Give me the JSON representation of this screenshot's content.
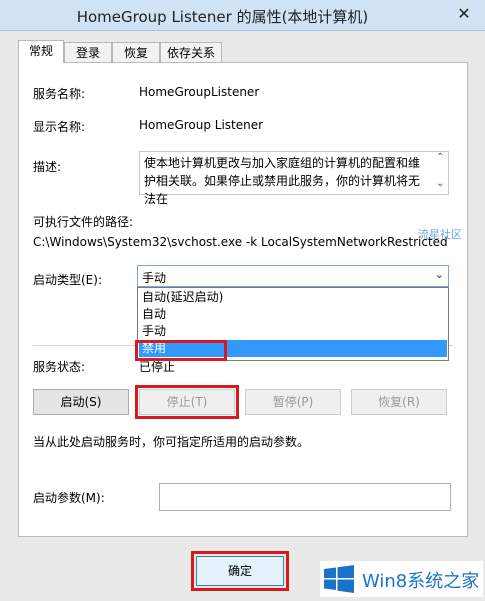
{
  "window": {
    "title": "HomeGroup Listener 的属性(本地计算机)",
    "close_glyph": "✕"
  },
  "tabs": [
    {
      "label": "常规",
      "active": true
    },
    {
      "label": "登录"
    },
    {
      "label": "恢复"
    },
    {
      "label": "依存关系"
    }
  ],
  "general": {
    "service_name_label": "服务名称:",
    "service_name": "HomeGroupListener",
    "display_name_label": "显示名称:",
    "display_name": "HomeGroup Listener",
    "description_label": "描述:",
    "description": "使本地计算机更改与加入家庭组的计算机的配置和维护相关联。如果停止或禁用此服务，你的计算机将无法在",
    "exe_path_label": "可执行文件的路径:",
    "exe_path": "C:\\Windows\\System32\\svchost.exe -k LocalSystemNetworkRestricted",
    "startup_type_label": "启动类型(E):",
    "startup_type_value": "手动",
    "startup_options": [
      "自动(延迟启动)",
      "自动",
      "手动",
      "禁用"
    ],
    "service_status_label": "服务状态:",
    "service_status": "已停止",
    "buttons": {
      "start": "启动(S)",
      "stop": "停止(T)",
      "pause": "暂停(P)",
      "resume": "恢复(R)"
    },
    "hint": "当从此处启动服务时，你可指定所适用的启动参数。",
    "start_params_label": "启动参数(M):",
    "start_params_value": ""
  },
  "footer": {
    "ok": "确定"
  },
  "watermark": {
    "text": "流星社区"
  },
  "branding": {
    "text": "Win8系统之家",
    "color": "#1b73c9"
  }
}
